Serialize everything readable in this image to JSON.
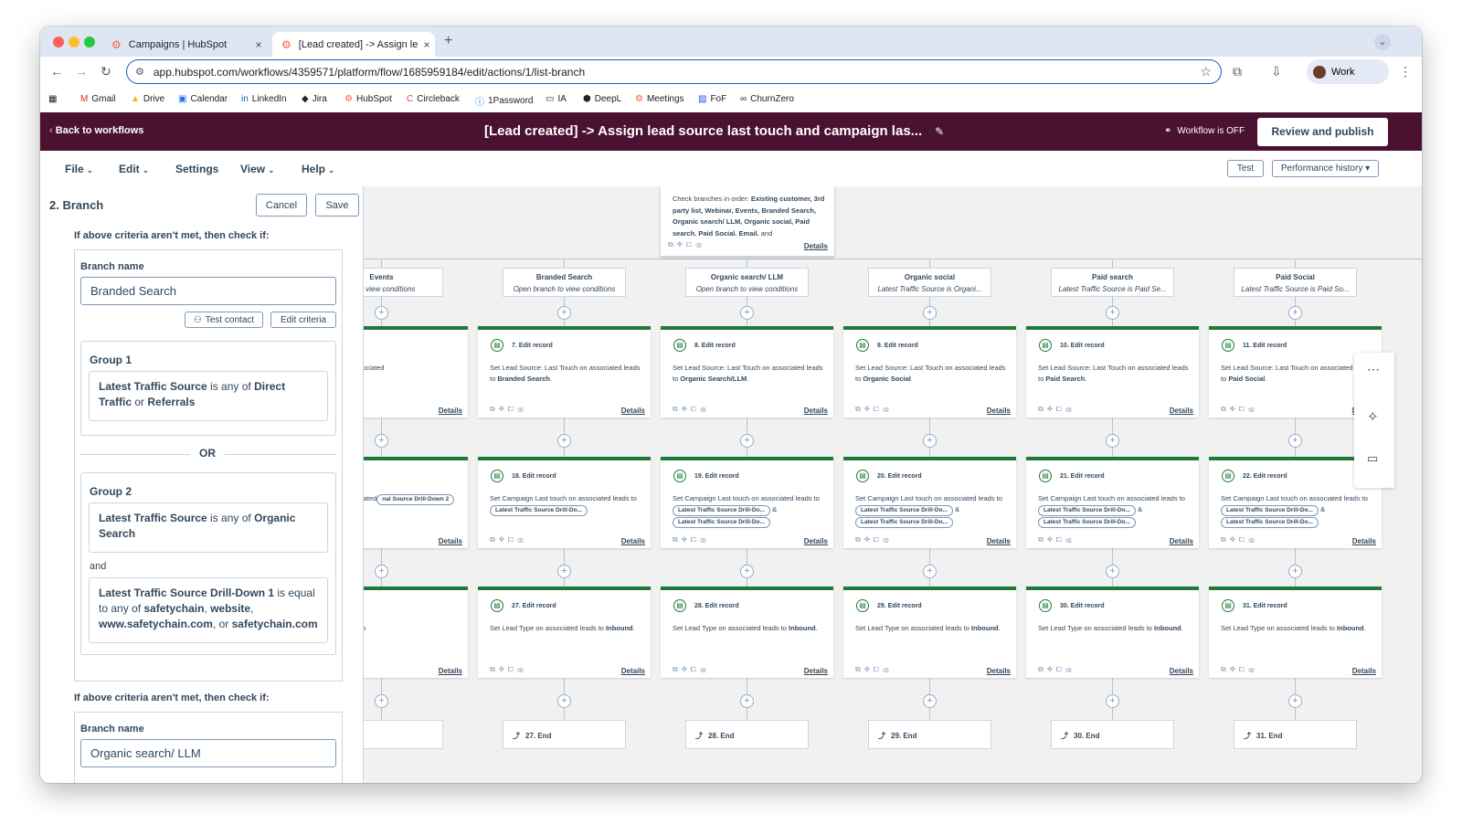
{
  "tabs": [
    {
      "title": "Campaigns | HubSpot"
    },
    {
      "title": "[Lead created] -> Assign lead"
    }
  ],
  "url": "app.hubspot.com/workflows/4359571/platform/flow/1685959184/edit/actions/1/list-branch",
  "profile": "Work",
  "bookmarks": [
    "Gmail",
    "Drive",
    "Calendar",
    "LinkedIn",
    "Jira",
    "HubSpot",
    "Circleback",
    "1Password",
    "IA",
    "DeepL",
    "Meetings",
    "FoF",
    "ChurnZero"
  ],
  "header": {
    "back": "Back to workflows",
    "title": "[Lead created] -> Assign lead source last touch and campaign las...",
    "status": "Workflow is OFF",
    "publish": "Review and publish"
  },
  "menu": {
    "file": "File",
    "edit": "Edit",
    "settings": "Settings",
    "view": "View",
    "help": "Help",
    "test": "Test",
    "perf": "Performance history"
  },
  "panel": {
    "title": "2. Branch",
    "cancel": "Cancel",
    "save": "Save",
    "criteria_label": "If above criteria aren't met, then check if:",
    "branch_name_label": "Branch name",
    "branch_name_value": "Branded Search",
    "test_contact": "Test contact",
    "edit_criteria": "Edit criteria",
    "group1": {
      "title": "Group 1",
      "c1_prop": "Latest Traffic Source",
      "c1_op": " is any of ",
      "c1_v1": "Direct Traffic",
      "c1_or": " or ",
      "c1_v2": "Referrals"
    },
    "or_label": "OR",
    "group2": {
      "title": "Group 2",
      "c1_prop": "Latest Traffic Source",
      "c1_op": " is any of ",
      "c1_v1": "Organic Search",
      "and_label": "and",
      "c2_prop": "Latest Traffic Source Drill-Down 1",
      "c2_op": " is equal to any of ",
      "c2_v1": "safetychain",
      "c2_s1": ", ",
      "c2_v2": "website",
      "c2_s2": ", ",
      "c2_v3": "www.safetychain.com",
      "c2_s3": ", or ",
      "c2_v4": "safetychain.com"
    },
    "criteria_label2": "If above criteria aren't met, then check if:",
    "branch_name_label2": "Branch name",
    "branch_name_value2": "Organic search/ LLM"
  },
  "canvas": {
    "top_node": {
      "p1": "Check branches in order: ",
      "p2": "Existing customer, 3rd party list, Webinar, Events, Branded Search, Organic search/ LLM, Organic social, Paid search, Paid Social, Email,",
      "p3": " and",
      "details": "Details"
    },
    "details": "Details",
    "branches": [
      {
        "name": "Events",
        "desc": "ch to view conditions",
        "r1": {
          "title": "rd",
          "pre": "Last Touch on associated",
          "bold": ""
        },
        "r2": {
          "title": "ord",
          "pre": "ist touch on associated",
          "pill1": "nal Source Drill-Down 2"
        },
        "r3": {
          "title": "ord",
          "pre": "associated leads to",
          "bold": ""
        },
        "end": ""
      },
      {
        "name": "Branded Search",
        "desc": "Open branch to view conditions",
        "r1": {
          "title": "7. Edit record",
          "pre": "Set Lead Source: Last Touch on associated leads to ",
          "bold": "Branded Search",
          "post": "."
        },
        "r2": {
          "title": "18. Edit record",
          "pre": "Set Campaign Last touch on associated leads to ",
          "pill1": "Latest Traffic Source Drill-Do..."
        },
        "r3": {
          "title": "27. Edit record",
          "pre": "Set Lead Type on associated leads to ",
          "bold": "Inbound",
          "post": "."
        },
        "end": "27. End"
      },
      {
        "name": "Organic search/ LLM",
        "desc": "Open branch to view conditions",
        "r1": {
          "title": "8. Edit record",
          "pre": "Set Lead Source: Last Touch on associated leads to ",
          "bold": "Organic Search/LLM",
          "post": "."
        },
        "r2": {
          "title": "19. Edit record",
          "pre": "Set Campaign Last touch on associated leads to ",
          "pill1": "Latest Traffic Source Drill-Do...",
          "amp": " &",
          "pill2": "Latest Traffic Source Drill-Do..."
        },
        "r3": {
          "title": "28. Edit record",
          "pre": "Set Lead Type on associated leads to ",
          "bold": "Inbound",
          "post": "."
        },
        "end": "28. End"
      },
      {
        "name": "Organic social",
        "desc": "Latest Traffic Source is Organi...",
        "r1": {
          "title": "9. Edit record",
          "pre": "Set Lead Source: Last Touch on associated leads to ",
          "bold": "Organic Social",
          "post": "."
        },
        "r2": {
          "title": "20. Edit record",
          "pre": "Set Campaign Last touch on associated leads to ",
          "pill1": "Latest Traffic Source Drill-Do...",
          "amp": " &",
          "pill2": "Latest Traffic Source Drill-Do..."
        },
        "r3": {
          "title": "29. Edit record",
          "pre": "Set Lead Type on associated leads to ",
          "bold": "Inbound",
          "post": "."
        },
        "end": "29. End"
      },
      {
        "name": "Paid search",
        "desc": "Latest Traffic Source is Paid Se...",
        "r1": {
          "title": "10. Edit record",
          "pre": "Set Lead Source: Last Touch on associated leads to ",
          "bold": "Paid Search",
          "post": "."
        },
        "r2": {
          "title": "21. Edit record",
          "pre": "Set Campaign Last touch on associated leads to ",
          "pill1": "Latest Traffic Source Drill-Do...",
          "amp": " &",
          "pill2": "Latest Traffic Source Drill-Do..."
        },
        "r3": {
          "title": "30. Edit record",
          "pre": "Set Lead Type on associated leads to ",
          "bold": "Inbound",
          "post": "."
        },
        "end": "30. End"
      },
      {
        "name": "Paid Social",
        "desc": "Latest Traffic Source is Paid So...",
        "r1": {
          "title": "11. Edit record",
          "pre": "Set Lead Source: Last Touch on associated leads to ",
          "bold": "Paid Social",
          "post": "."
        },
        "r2": {
          "title": "22. Edit record",
          "pre": "Set Campaign Last touch on associated leads to ",
          "pill1": "Latest Traffic Source Drill-Do...",
          "amp": " &",
          "pill2": "Latest Traffic Source Drill-Do..."
        },
        "r3": {
          "title": "31. Edit record",
          "pre": "Set Lead Type on associated leads to ",
          "bold": "Inbound",
          "post": "."
        },
        "end": "31. End"
      }
    ]
  },
  "colors": {
    "brand_header": "#4a1130",
    "edit_record_accent": "#1f7a3a",
    "url_focus": "#1a56c9"
  }
}
